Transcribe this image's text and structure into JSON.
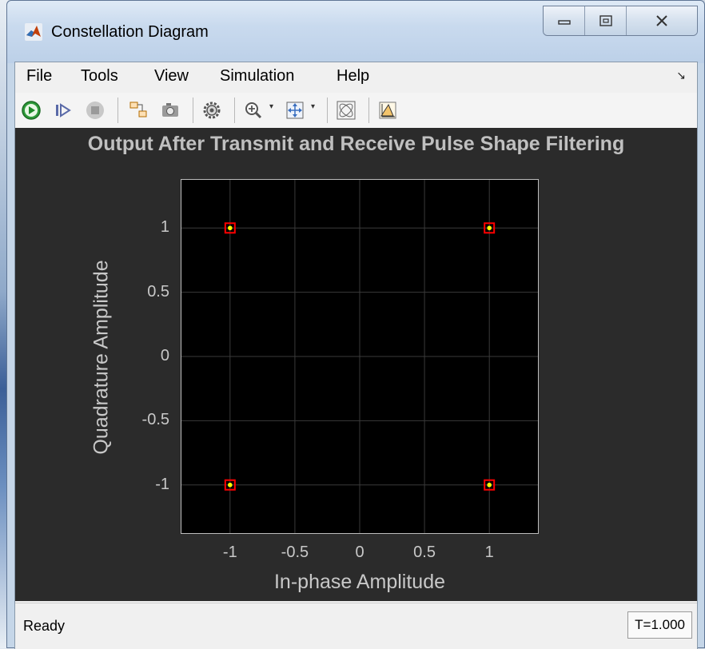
{
  "window": {
    "title": "Constellation Diagram"
  },
  "menu": {
    "items": [
      "File",
      "Tools",
      "View",
      "Simulation",
      "Help"
    ]
  },
  "toolbar": {
    "icons": [
      "run-icon",
      "step-forward-icon",
      "stop-icon",
      "highlight-block-icon",
      "snapshot-icon",
      "settings-icon",
      "zoom-in-icon",
      "fit-view-icon",
      "reference-constellation-icon",
      "measurement-icon"
    ]
  },
  "plot": {
    "title": "Output After Transmit and Receive Pulse Shape Filtering",
    "xlabel": "In-phase Amplitude",
    "ylabel": "Quadrature Amplitude"
  },
  "chart_data": {
    "type": "scatter",
    "title": "Output After Transmit and Receive Pulse Shape Filtering",
    "xlabel": "In-phase Amplitude",
    "ylabel": "Quadrature Amplitude",
    "xlim": [
      -1.375,
      1.375
    ],
    "ylim": [
      -1.375,
      1.375
    ],
    "xticks": [
      "-1",
      "-0.5",
      "0",
      "0.5",
      "1"
    ],
    "yticks": [
      "1",
      "0.5",
      "0",
      "-0.5",
      "-1"
    ],
    "grid": true,
    "points": [
      {
        "x": -1,
        "y": 1
      },
      {
        "x": 1,
        "y": 1
      },
      {
        "x": -1,
        "y": -1
      },
      {
        "x": 1,
        "y": -1
      }
    ],
    "reference_points": [
      {
        "x": -1,
        "y": 1
      },
      {
        "x": 1,
        "y": 1
      },
      {
        "x": -1,
        "y": -1
      },
      {
        "x": 1,
        "y": -1
      }
    ],
    "colors": {
      "background": "#000000",
      "signal": "#ffff00",
      "reference": "#ff0000",
      "grid": "#3a3a3a"
    }
  },
  "status": {
    "text": "Ready",
    "time": "T=1.000"
  }
}
